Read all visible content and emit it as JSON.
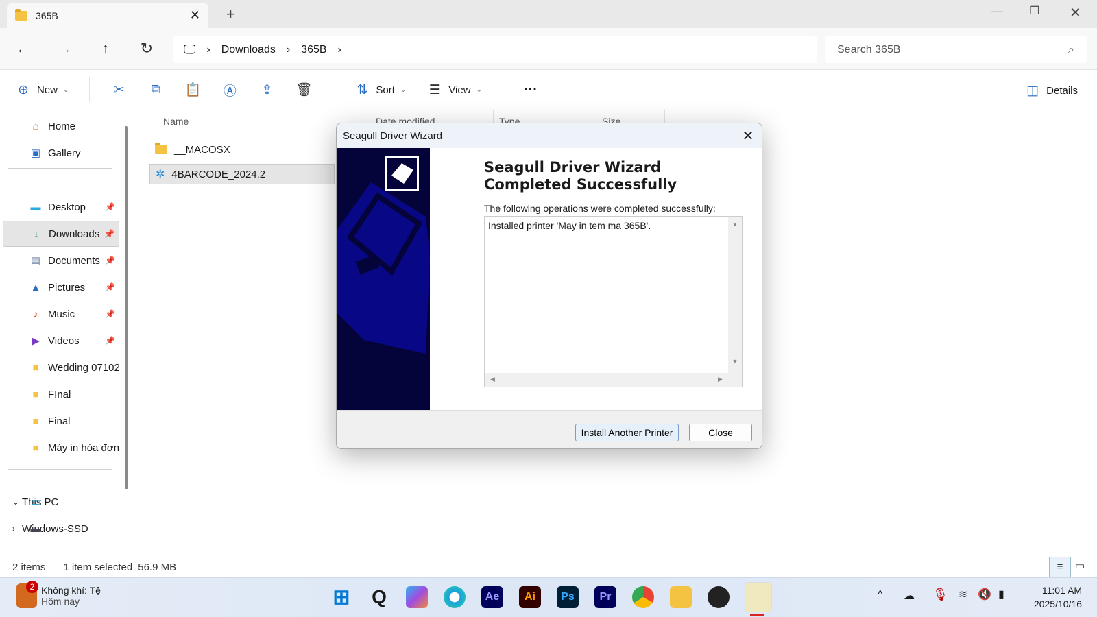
{
  "window": {
    "tab_title": "365B"
  },
  "address": {
    "crumbs": [
      "Downloads",
      "365B"
    ],
    "search_placeholder": "Search 365B"
  },
  "toolbar": {
    "new": "New",
    "sort": "Sort",
    "view": "View",
    "details": "Details"
  },
  "sidebar": {
    "items": [
      {
        "label": "Home",
        "icon": "home-icon"
      },
      {
        "label": "Gallery",
        "icon": "gallery-icon"
      },
      {
        "label": "Desktop",
        "icon": "desktop-icon",
        "pinned": true
      },
      {
        "label": "Downloads",
        "icon": "download-icon",
        "pinned": true,
        "selected": true
      },
      {
        "label": "Documents",
        "icon": "documents-icon",
        "pinned": true
      },
      {
        "label": "Pictures",
        "icon": "pictures-icon",
        "pinned": true
      },
      {
        "label": "Music",
        "icon": "music-icon",
        "pinned": true
      },
      {
        "label": "Videos",
        "icon": "videos-icon",
        "pinned": true
      },
      {
        "label": "Wedding 07102",
        "icon": "folder-icon"
      },
      {
        "label": "FInal",
        "icon": "folder-icon"
      },
      {
        "label": "Final",
        "icon": "folder-icon"
      },
      {
        "label": "Máy in hóa đơn",
        "icon": "folder-icon"
      },
      {
        "label": "This PC",
        "icon": "pc-icon"
      },
      {
        "label": "Windows-SSD",
        "icon": "drive-icon"
      }
    ]
  },
  "columns": [
    "Name",
    "Date modified",
    "Type",
    "Size"
  ],
  "files": [
    {
      "name": "__MACOSX",
      "type": "folder"
    },
    {
      "name": "4BARCODE_2024.2",
      "type": "installer",
      "selected": true
    }
  ],
  "status": {
    "count": "2 items",
    "selection": "1 item selected",
    "size": "56.9 MB"
  },
  "dialog": {
    "title": "Seagull Driver Wizard",
    "heading": "Seagull Driver Wizard Completed Successfully",
    "subtitle": "The following operations were completed successfully:",
    "operations": [
      "Installed printer 'May in tem ma 365B'."
    ],
    "install_another": "Install Another Printer",
    "close": "Close"
  },
  "taskbar": {
    "weather_title": "Không khí: Tệ",
    "weather_sub": "Hôm nay",
    "weather_badge": "2",
    "time": "11:01 AM",
    "date": "2025/10/16",
    "apps": [
      {
        "name": "Ae",
        "bg": "#00005b",
        "fg": "#9999ff"
      },
      {
        "name": "Ai",
        "bg": "#330000",
        "fg": "#ff9a00"
      },
      {
        "name": "Ps",
        "bg": "#001e36",
        "fg": "#31a8ff"
      },
      {
        "name": "Pr",
        "bg": "#00005b",
        "fg": "#9999ff"
      }
    ]
  }
}
